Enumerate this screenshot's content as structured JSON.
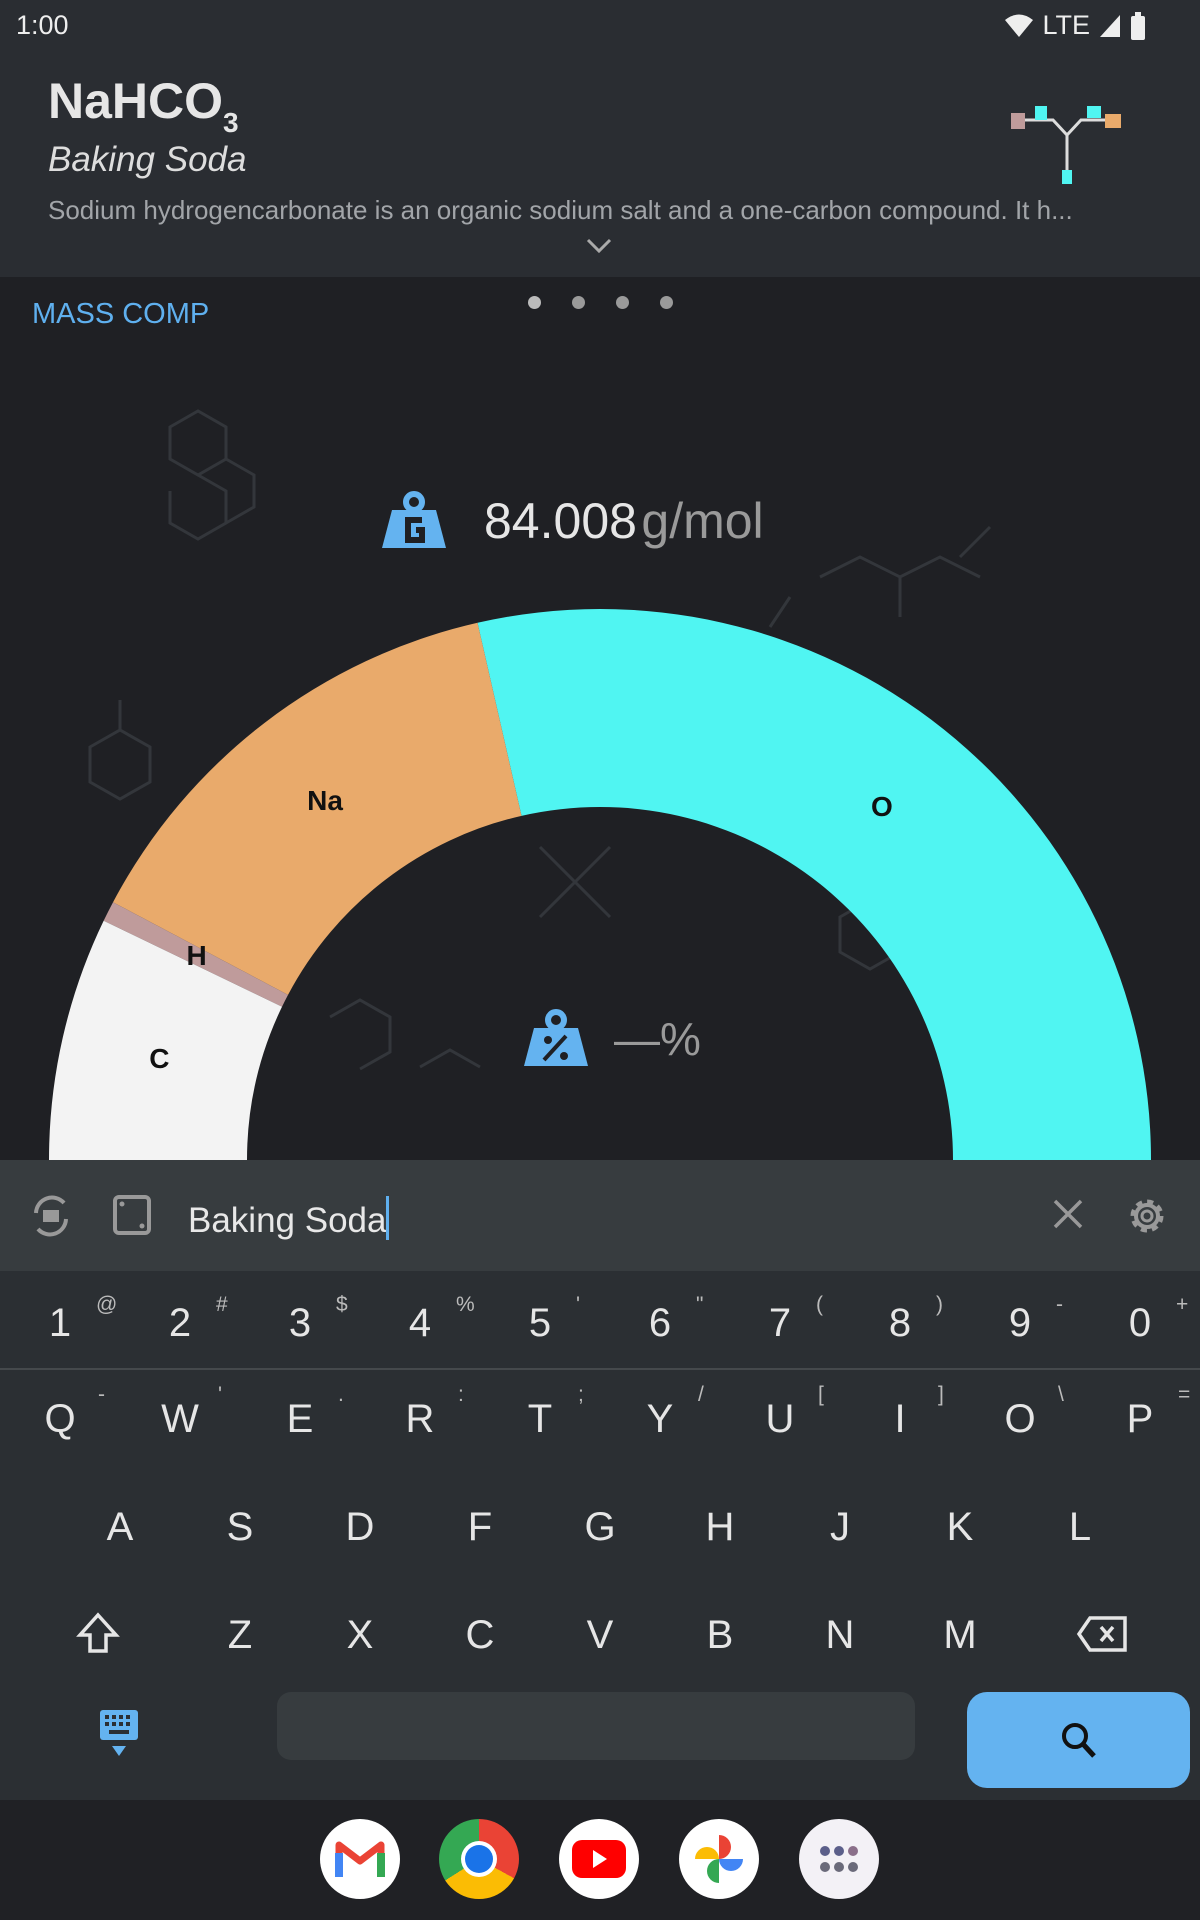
{
  "status_bar": {
    "time": "1:00",
    "network": "LTE",
    "icons": [
      "wifi-icon",
      "signal-icon",
      "battery-icon"
    ]
  },
  "header": {
    "formula_main": "NaHCO",
    "formula_sub": "3",
    "name": "Baking Soda",
    "description": "Sodium hydrogencarbonate is an organic sodium salt and a one-carbon compound. It h...",
    "expand_icon": "chevron-down-icon"
  },
  "tab": {
    "label": "MASS COMP",
    "page_count": 4,
    "active_page": 1
  },
  "molar_mass": {
    "value": "84.008",
    "unit": "g/mol",
    "icon": "weight-g-icon"
  },
  "percent": {
    "value": "—%",
    "icon": "weight-percent-icon"
  },
  "chart_data": {
    "type": "pie",
    "style": "half-donut",
    "categories": [
      "O",
      "Na",
      "H",
      "C"
    ],
    "values": [
      47.998,
      22.99,
      1.008,
      12.011
    ],
    "colors": [
      "#50f5f2",
      "#e9aa6b",
      "#bf9b9b",
      "#f3f3f3"
    ]
  },
  "search": {
    "value": "Baking Soda",
    "icons": [
      "keyboard-switch-icon",
      "clipboard-icon",
      "clear-icon",
      "settings-icon"
    ]
  },
  "keyboard": {
    "numbers": [
      "1",
      "2",
      "3",
      "4",
      "5",
      "6",
      "7",
      "8",
      "9",
      "0"
    ],
    "number_alts": [
      "@",
      "#",
      "$",
      "%",
      "'",
      "\"",
      "(",
      ")",
      "-",
      "+"
    ],
    "row1": [
      "Q",
      "W",
      "E",
      "R",
      "T",
      "Y",
      "U",
      "I",
      "O",
      "P"
    ],
    "row1_alts": [
      "-",
      "'",
      ".",
      ":",
      ";",
      "/",
      "[",
      "]",
      "\\",
      "="
    ],
    "row2": [
      "A",
      "S",
      "D",
      "F",
      "G",
      "H",
      "J",
      "K",
      "L"
    ],
    "row3": [
      "Z",
      "X",
      "C",
      "V",
      "B",
      "N",
      "M"
    ]
  },
  "dock": {
    "apps": [
      "Gmail",
      "Chrome",
      "YouTube",
      "Photos",
      "App drawer"
    ]
  }
}
